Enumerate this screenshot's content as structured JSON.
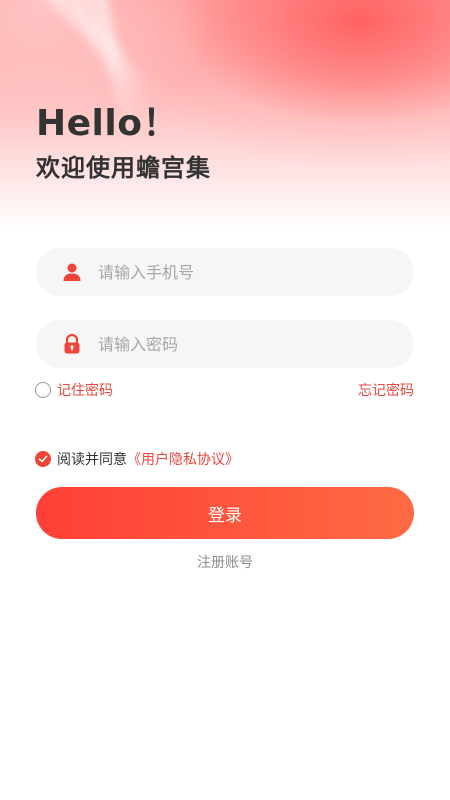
{
  "header": {
    "greeting": "Hello！",
    "welcome": "欢迎使用蟾宫集"
  },
  "form": {
    "phone": {
      "placeholder": "请输入手机号",
      "icon": "user-icon"
    },
    "password": {
      "placeholder": "请输入密码",
      "icon": "lock-icon"
    },
    "remember_label": "记住密码",
    "forgot_label": "忘记密码",
    "agree_prefix": "阅读并同意",
    "agreement_link": "《用户隐私协议》",
    "login_label": "登录",
    "register_label": "注册账号"
  },
  "colors": {
    "accent": "#ef4438",
    "button_start": "#ff3f36",
    "button_end": "#ff6a44",
    "field_bg": "#f6f6f6",
    "title": "#333333"
  }
}
